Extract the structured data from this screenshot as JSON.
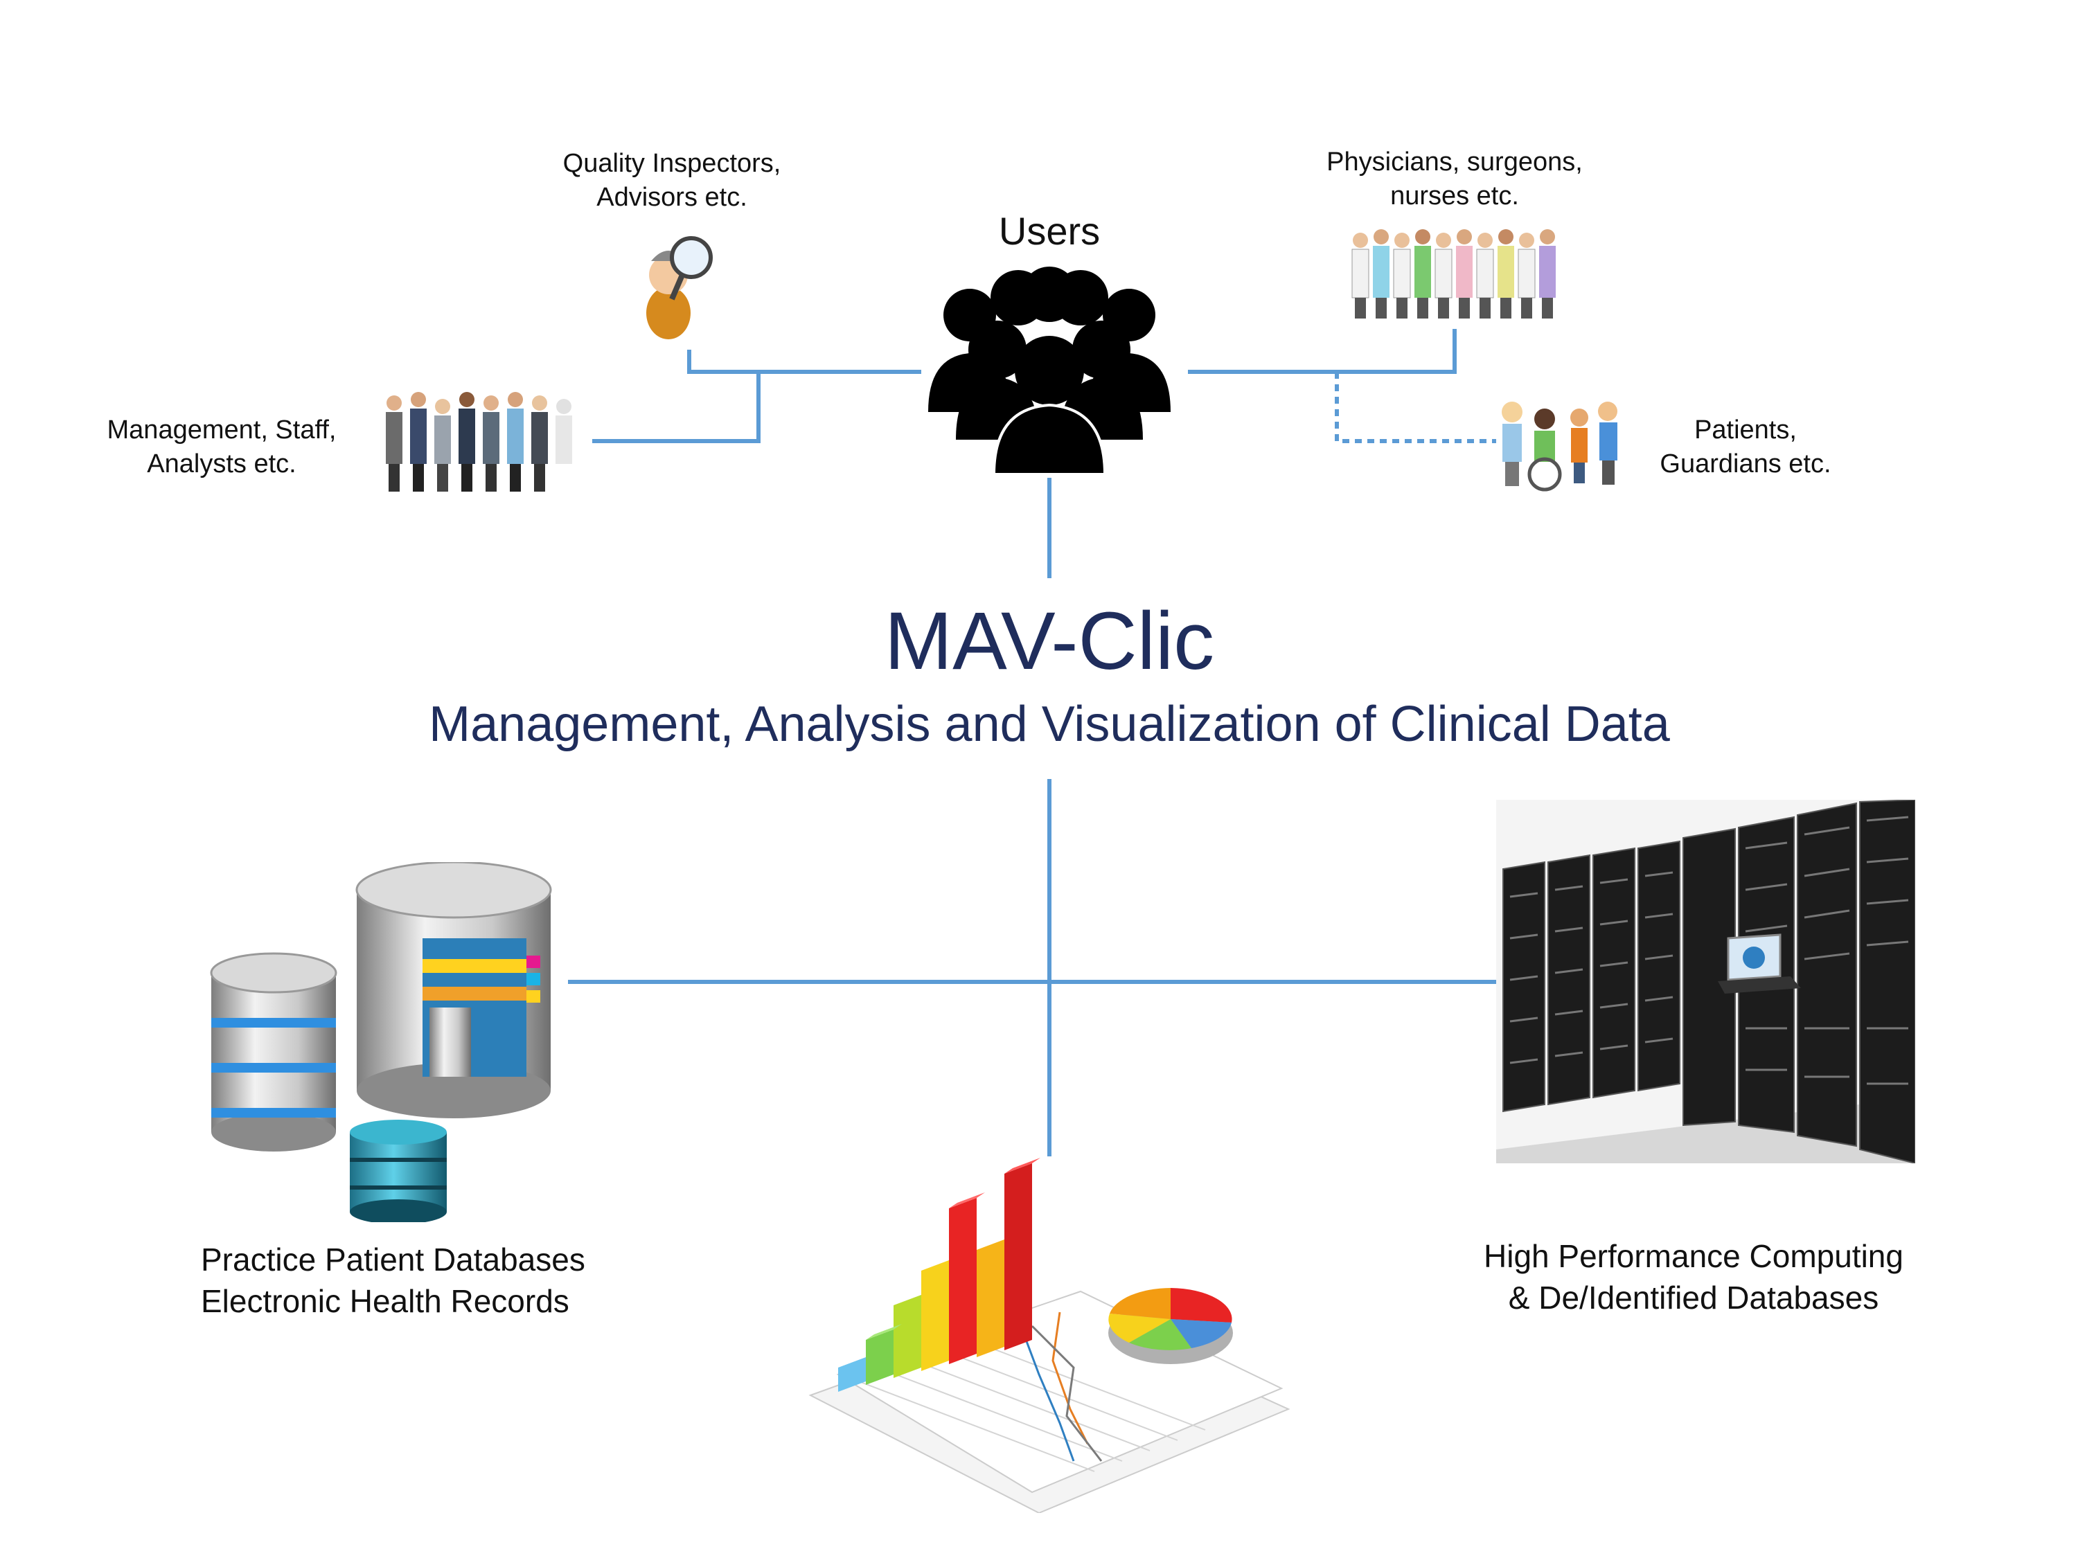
{
  "title": "MAV-Clic",
  "subtitle": "Management, Analysis and Visualization of Clinical Data",
  "users": {
    "label": "Users",
    "groups": {
      "quality": "Quality Inspectors,\nAdvisors etc.",
      "clinicians": "Physicians, surgeons,\nnurses etc.",
      "management": "Management, Staff,\nAnalysts etc.",
      "patients": "Patients,\nGuardians etc."
    }
  },
  "resources": {
    "databases": "Practice Patient Databases\nElectronic Health Records",
    "hpc": "High Performance Computing\n& De/Identified Databases"
  },
  "icons": [
    "users-icon",
    "quality-inspector-icon",
    "clinicians-icon",
    "management-staff-icon",
    "patients-icon",
    "database-icon",
    "server-rack-icon",
    "analytics-chart-icon"
  ],
  "colors": {
    "connector": "#5b9bd5",
    "title": "#1f2d5c"
  }
}
